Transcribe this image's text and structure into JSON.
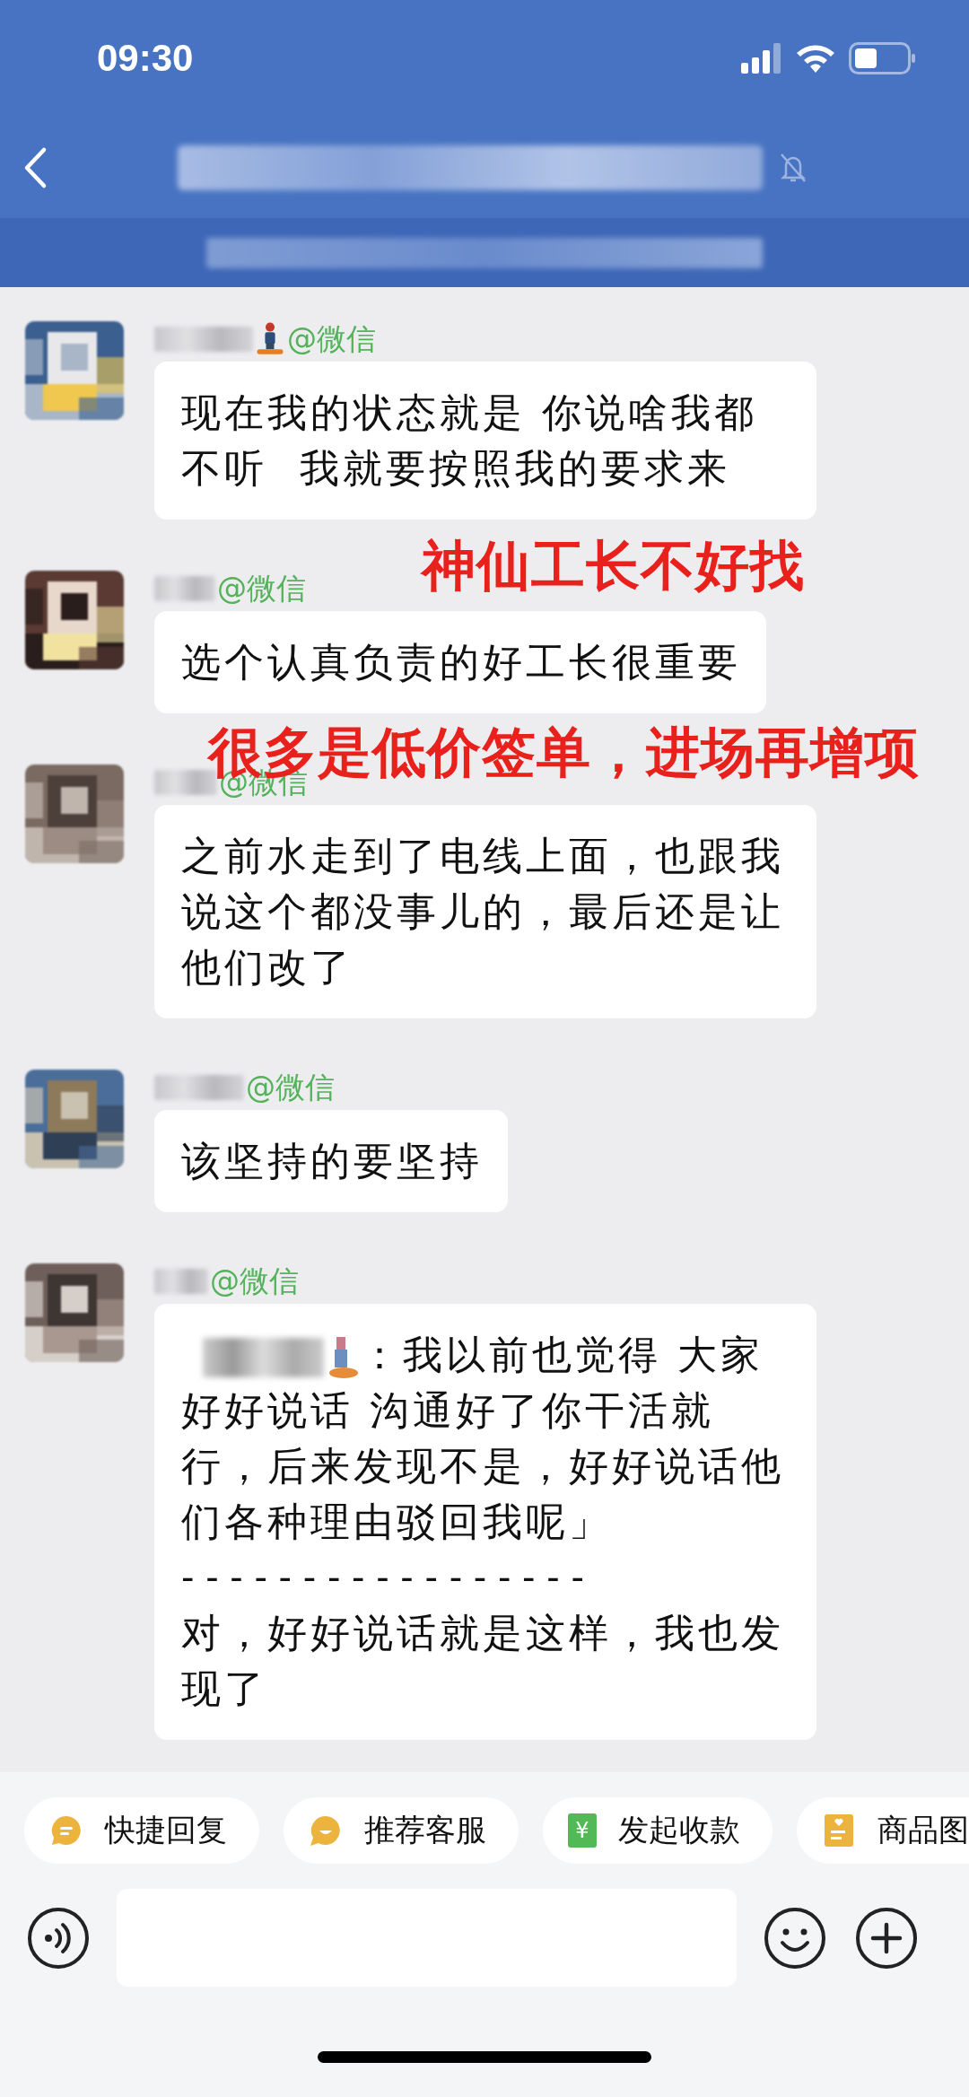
{
  "status_bar": {
    "time": "09:30"
  },
  "nav": {
    "muted": true
  },
  "messages": [
    {
      "kind": "text",
      "sender_suffix": "@微信",
      "sender_icon": true,
      "text": "现在我的状态就是 你说啥我都不听  我就要按照我的要求来"
    },
    {
      "kind": "text",
      "sender_suffix": "@微信",
      "sender_icon": false,
      "text": "选个认真负责的好工长很重要"
    },
    {
      "kind": "text",
      "sender_suffix": "@微信",
      "sender_icon": false,
      "text": "之前水走到了电线上面，也跟我说这个都没事儿的，最后还是让他们改了"
    },
    {
      "kind": "text",
      "sender_suffix": "@微信",
      "sender_icon": false,
      "text": "该坚持的要坚持"
    },
    {
      "kind": "quote_reply",
      "sender_suffix": "@微信",
      "sender_icon": false,
      "quote_icon": true,
      "quote": "：我以前也觉得 大家好好说话 沟通好了你干活就行，后来发现不是，好好说话他们各种理由驳回我呢」",
      "divider": "- - - - - - - - - - - - - - - - -",
      "text": "对，好好说话就是这样，我也发现了"
    }
  ],
  "annotations": [
    {
      "text": "神仙工长不好找"
    },
    {
      "text": "很多是低价签单，进场再增项"
    }
  ],
  "shortcuts": [
    {
      "kind": "quick_reply",
      "label": "快捷回复"
    },
    {
      "kind": "recommend",
      "label": "推荐客服"
    },
    {
      "kind": "payment",
      "label": "发起收款",
      "icon_text": "¥"
    },
    {
      "kind": "catalog",
      "label": "商品图"
    }
  ]
}
